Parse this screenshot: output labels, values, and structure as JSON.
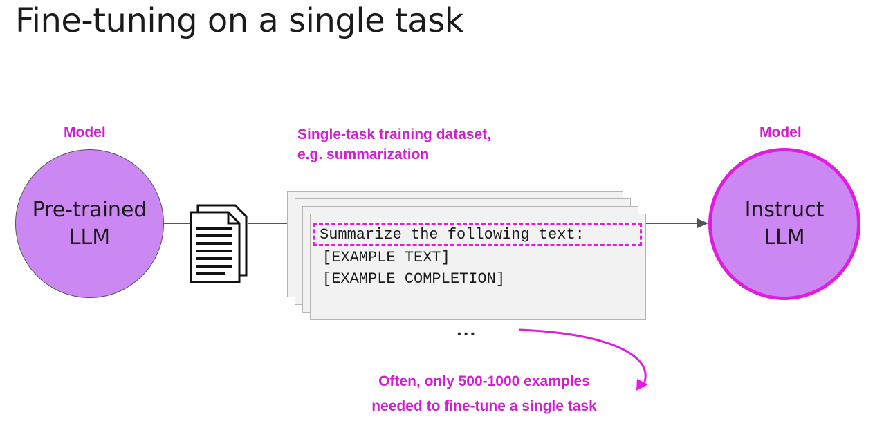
{
  "title": "Fine-tuning on a single task",
  "left_model": {
    "label": "Model",
    "name_line1": "Pre-trained",
    "name_line2": "LLM"
  },
  "right_model": {
    "label": "Model",
    "name_line1": "Instruct",
    "name_line2": "LLM"
  },
  "dataset": {
    "label_line1": "Single-task training dataset,",
    "label_line2": "e.g. summarization",
    "prompt": "Summarize the following text:",
    "example_text": "[EXAMPLE TEXT]",
    "example_completion": "[EXAMPLE COMPLETION]",
    "ellipsis": "..."
  },
  "note": {
    "line1": "Often, only 500-1000 examples",
    "line2": "needed to fine-tune a single task"
  },
  "icons": {
    "document": "document-stack-icon"
  },
  "colors": {
    "accent": "#d21ed2",
    "model_fill": "#cc88f2"
  }
}
